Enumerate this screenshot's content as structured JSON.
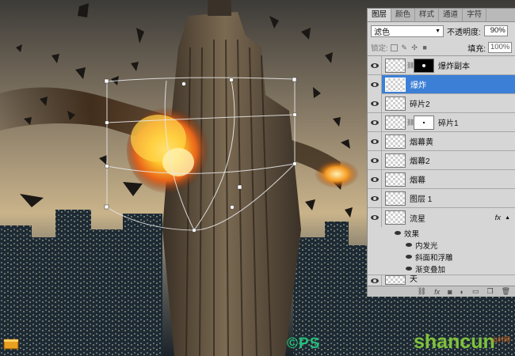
{
  "panel": {
    "tabs": [
      "图层",
      "颜色",
      "样式",
      "通道",
      "字符"
    ],
    "blend_mode": "滤色",
    "opacity_label": "不透明度:",
    "opacity_value": "90%",
    "lock_label": "锁定:",
    "fill_label": "填充:",
    "fill_value": "100%",
    "layers": [
      {
        "name": "爆炸副本"
      },
      {
        "name": "爆炸"
      },
      {
        "name": "碎片2"
      },
      {
        "name": "碎片1"
      },
      {
        "name": "烟幕黄"
      },
      {
        "name": "烟幕2"
      },
      {
        "name": "烟幕"
      },
      {
        "name": "图层 1"
      },
      {
        "name": "流星"
      }
    ],
    "effects_label": "效果",
    "effects": [
      "内发光",
      "斜面和浮雕",
      "渐变叠加"
    ],
    "last_layer_name": "天"
  },
  "watermark": {
    "ps_logo": "PS",
    "site": "shancun",
    "site_sub": "山村网"
  }
}
